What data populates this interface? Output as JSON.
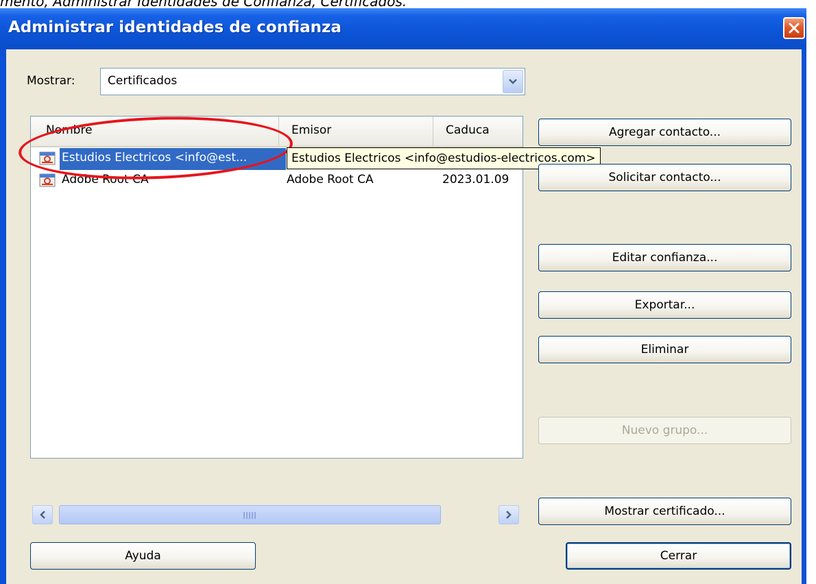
{
  "caption": "mento, Administrar Identidades de Confianza, Certificados.",
  "window": {
    "title": "Administrar identidades de confianza",
    "close_icon": "close-icon"
  },
  "filter": {
    "label": "Mostrar:",
    "value": "Certificados"
  },
  "list": {
    "columns": [
      "Nombre",
      "Emisor",
      "Caduca"
    ],
    "rows": [
      {
        "name": "Estudios Electricos <info@est...",
        "issuer": "Estudios Electricos <info@estudios-electricos.com>",
        "expires": "",
        "selected": true
      },
      {
        "name": "Adobe Root CA",
        "issuer": "Adobe Root CA",
        "expires": "2023.01.09",
        "selected": false
      }
    ]
  },
  "tooltip": "Estudios Electricos <info@estudios-electricos.com>",
  "buttons": {
    "add_contact": "Agregar contacto...",
    "request_contact": "Solicitar contacto...",
    "edit_trust": "Editar confianza...",
    "export": "Exportar...",
    "delete": "Eliminar",
    "new_group": "Nuevo grupo...",
    "show_certificate": "Mostrar certificado...",
    "help": "Ayuda",
    "close": "Cerrar"
  },
  "colors": {
    "title_bar": "#0a51d7",
    "selection": "#316ac5",
    "annotation": "#e8141b",
    "tooltip_bg": "#ffffe1"
  }
}
